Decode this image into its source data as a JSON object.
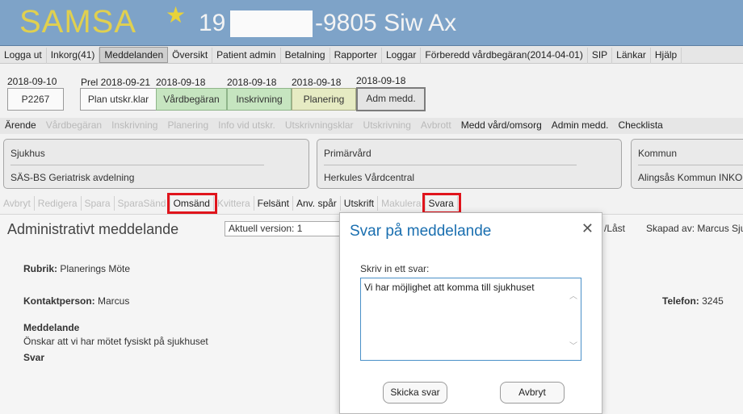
{
  "app": {
    "logo": "SAMSA",
    "patient_prefix": "19",
    "patient_suffix": "-9805 Siw Ax"
  },
  "menubar": [
    "Logga ut",
    "Inkorg(41)",
    "Meddelanden",
    "Översikt",
    "Patient admin",
    "Betalning",
    "Rapporter",
    "Loggar",
    "Förberedd vårdbegäran(2014-04-01)",
    "SIP",
    "Länkar",
    "Hjälp"
  ],
  "timeline": {
    "start_date": "2018-09-10",
    "start_box": "P2267",
    "prel_date": "Prel 2018-09-21",
    "plan_label": "Plan utskr.klar",
    "steps": [
      {
        "date": "2018-09-18",
        "label": "Vårdbegäran"
      },
      {
        "date": "2018-09-18",
        "label": "Inskrivning"
      },
      {
        "date": "2018-09-18",
        "label": "Planering"
      },
      {
        "date": "2018-09-18",
        "label": "Adm medd."
      }
    ]
  },
  "menu2": [
    {
      "label": "Ärende",
      "enabled": true
    },
    {
      "label": "Vårdbegäran",
      "enabled": false
    },
    {
      "label": "Inskrivning",
      "enabled": false
    },
    {
      "label": "Planering",
      "enabled": false
    },
    {
      "label": "Info vid utskr.",
      "enabled": false
    },
    {
      "label": "Utskrivningsklar",
      "enabled": false
    },
    {
      "label": "Utskrivning",
      "enabled": false
    },
    {
      "label": "Avbrott",
      "enabled": false
    },
    {
      "label": "Medd vård/omsorg",
      "enabled": true
    },
    {
      "label": "Admin medd.",
      "enabled": true
    },
    {
      "label": "Checklista",
      "enabled": true
    }
  ],
  "cards": [
    {
      "title": "Sjukhus",
      "value": "SÄS-BS Geriatrisk avdelning"
    },
    {
      "title": "Primärvård",
      "value": "Herkules Vårdcentral"
    },
    {
      "title": "Kommun",
      "value": "Alingsås Kommun INKORG"
    }
  ],
  "actions": [
    {
      "label": "Avbryt",
      "enabled": false,
      "highlight": false
    },
    {
      "label": "Redigera",
      "enabled": false,
      "highlight": false
    },
    {
      "label": "Spara",
      "enabled": false,
      "highlight": false
    },
    {
      "label": "SparaSänd",
      "enabled": false,
      "highlight": false
    },
    {
      "label": "Omsänd",
      "enabled": true,
      "highlight": true
    },
    {
      "label": "Kvittera",
      "enabled": false,
      "highlight": false
    },
    {
      "label": "Felsänt",
      "enabled": true,
      "highlight": false
    },
    {
      "label": "Anv. spår",
      "enabled": true,
      "highlight": false
    },
    {
      "label": "Utskrift",
      "enabled": true,
      "highlight": false
    },
    {
      "label": "Makulera",
      "enabled": false,
      "highlight": false
    },
    {
      "label": "Svara",
      "enabled": true,
      "highlight": true
    }
  ],
  "main": {
    "title": "Administrativt meddelande",
    "version": "Aktuell version: 1",
    "lock": "/Låst",
    "created_by": "Skapad av: Marcus Sjul",
    "rubrik_label": "Rubrik:",
    "rubrik_value": "Planerings Möte",
    "kontakt_label": "Kontaktperson:",
    "kontakt_value": "Marcus",
    "telefon_label": "Telefon:",
    "telefon_value": "3245",
    "meddelande_label": "Meddelande",
    "meddelande_value": "Önskar att vi har mötet fysiskt på sjukhuset",
    "svar_label": "Svar"
  },
  "modal": {
    "title": "Svar på meddelande",
    "close": "✕",
    "label": "Skriv in ett svar:",
    "text": "Vi har möjlighet att komma till sjukhuset",
    "send": "Skicka svar",
    "cancel": "Avbryt"
  },
  "colors": {
    "header": "#7ea3c8",
    "logo": "#e0d050",
    "highlight": "#e0141c",
    "modal_title": "#1a6fb0"
  }
}
